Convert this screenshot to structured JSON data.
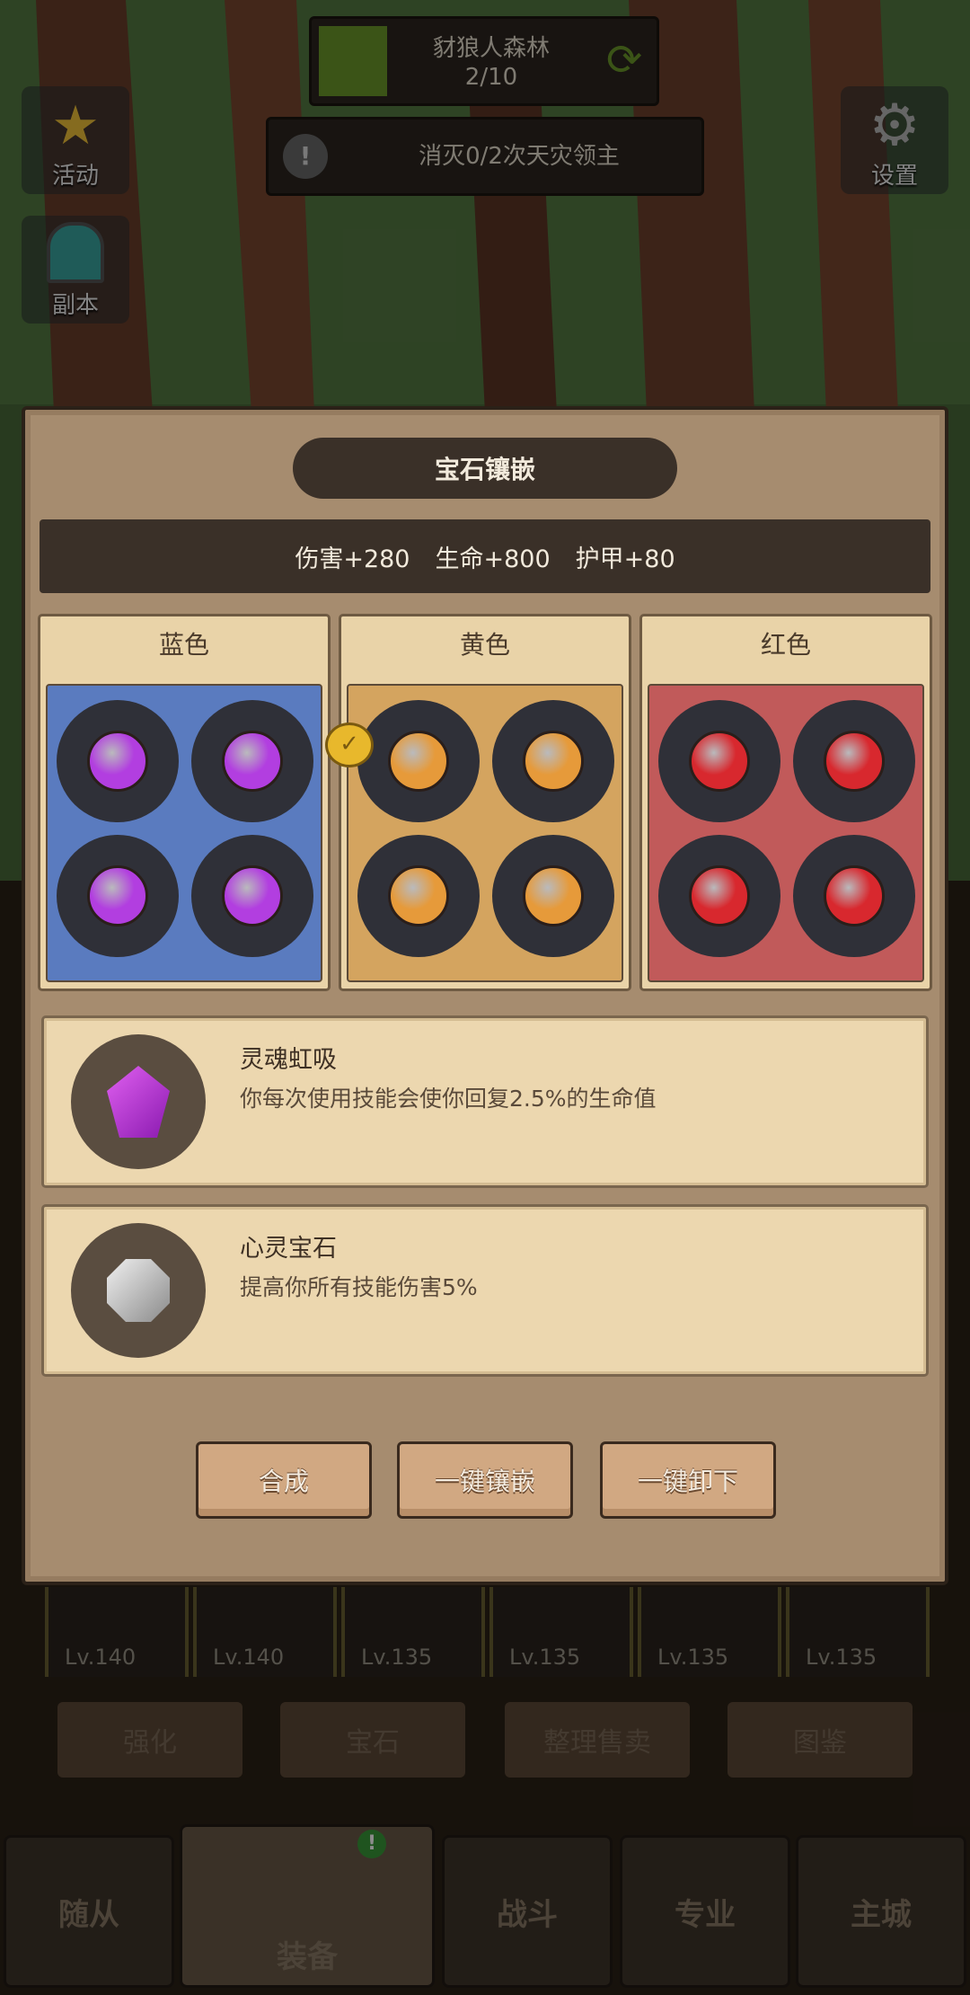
{
  "hud": {
    "stage_name": "豺狼人森林",
    "stage_progress": "2/10",
    "quest_text": "消灭0/2次天灾领主",
    "activity_label": "活动",
    "dungeon_label": "副本",
    "settings_label": "设置"
  },
  "panel": {
    "title": "宝石镶嵌",
    "stats": [
      "伤害+280",
      "生命+800",
      "护甲+80"
    ],
    "columns": [
      {
        "label": "蓝色",
        "bg": "#5a7bbf",
        "gem_color": "#b23ee0"
      },
      {
        "label": "黄色",
        "bg": "#d4a45f",
        "gem_color": "#e69a3a"
      },
      {
        "label": "红色",
        "bg": "#c15a5a",
        "gem_color": "#d8282e"
      }
    ],
    "skills": [
      {
        "name": "灵魂虹吸",
        "desc": "你每次使用技能会使你回复2.5%的生命值",
        "icon": "purple-crystal-icon"
      },
      {
        "name": "心灵宝石",
        "desc": "提高你所有技能伤害5%",
        "icon": "silver-gem-icon"
      }
    ],
    "buttons": {
      "combine": "合成",
      "inlay_all": "一键镶嵌",
      "remove_all": "一键卸下"
    }
  },
  "equipment_levels": [
    "Lv.140",
    "Lv.140",
    "Lv.135",
    "Lv.135",
    "Lv.135",
    "Lv.135"
  ],
  "menu": [
    "强化",
    "宝石",
    "整理售卖",
    "图鉴"
  ],
  "bottom_nav": [
    "随从",
    "装备",
    "战斗",
    "专业",
    "主城"
  ]
}
